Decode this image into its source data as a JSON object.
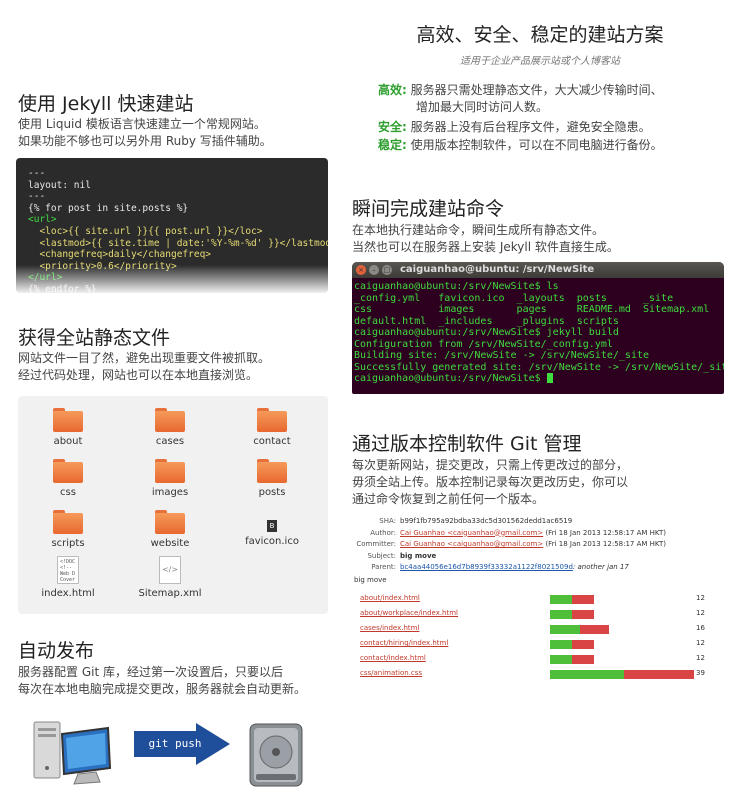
{
  "header": {
    "title": "高效、安全、稳定的建站方案",
    "subtitle": "适用于企业产品展示站或个人博客站",
    "features": [
      {
        "key": "高效:",
        "text": "服务器只需处理静态文件，大大减少传输时间、",
        "text2": "增加最大同时访问人数。"
      },
      {
        "key": "安全:",
        "text": "服务器上没有后台程序文件，避免安全隐患。"
      },
      {
        "key": "稳定:",
        "text": "使用版本控制软件，可以在不同电脑进行备份。"
      }
    ]
  },
  "jekyll": {
    "title": "使用 Jekyll 快速建站",
    "line1": "使用 Liquid 模板语言快速建立一个常规网站。",
    "line2": "如果功能不够也可以另外用 Ruby 写插件辅助。",
    "code": [
      {
        "t": "---",
        "c": "#e8e8e8"
      },
      {
        "t": "layout: nil",
        "c": "#e8e8e8"
      },
      {
        "t": "---",
        "c": "#e8e8e8"
      },
      {
        "t": "{% for post in site.posts %}",
        "c": "#e8e8e8"
      },
      {
        "t": "<url>",
        "c": "#3fdc3f"
      },
      {
        "t": "  <loc>{{ site.url }}{{ post.url }}</loc>",
        "c": "#e6db74"
      },
      {
        "t": "  <lastmod>{{ site.time | date:'%Y-%m-%d' }}</lastmod>",
        "c": "#e6db74"
      },
      {
        "t": "  <changefreq>daily</changefreq>",
        "c": "#e6db74"
      },
      {
        "t": "  <priority>0.6</priority>",
        "c": "#e6db74"
      },
      {
        "t": "</url>",
        "c": "#3fdc3f"
      },
      {
        "t": "{% endfor %}",
        "c": "#e8e8e8"
      }
    ]
  },
  "static": {
    "title": "获得全站静态文件",
    "line1": "网站文件一目了然，避免出现重要文件被抓取。",
    "line2": "经过代码处理，网站也可以在本地直接浏览。",
    "files": [
      "about",
      "cases",
      "contact",
      "css",
      "images",
      "posts",
      "scripts",
      "website",
      "favicon.ico",
      "index.html",
      "Sitemap.xml"
    ],
    "index_preview": "<!DOC\n<!--\nWeb D\nCover",
    "svg_glyph": "</>",
    "favicon_glyph": "B"
  },
  "build": {
    "title": "瞬间完成建站命令",
    "line1": "在本地执行建站命令，瞬间生成所有静态文件。",
    "line2": "当然也可以在服务器上安装 Jekyll 软件直接生成。"
  },
  "terminal": {
    "title": "caiguanhao@ubuntu: /srv/NewSite",
    "lines": [
      {
        "t": "caiguanhao@ubuntu:/srv/NewSite$ ls",
        "w": false
      },
      {
        "t": "_config.yml   favicon.ico  _layouts  posts      _site",
        "w": false
      },
      {
        "t": "css           images       pages     README.md  Sitemap.xml",
        "w": false
      },
      {
        "t": "default.html  _includes    _plugins  scripts",
        "w": false
      },
      {
        "t": "caiguanhao@ubuntu:/srv/NewSite$ jekyll build",
        "w": false
      },
      {
        "t": "Configuration from /srv/NewSite/_config.yml",
        "w": false
      },
      {
        "t": "Building site: /srv/NewSite -> /srv/NewSite/_site",
        "w": false
      },
      {
        "t": "Successfully generated site: /srv/NewSite -> /srv/NewSite/_site",
        "w": false
      },
      {
        "t": "caiguanhao@ubuntu:/srv/NewSite$ ",
        "w": false
      }
    ]
  },
  "git": {
    "title": "通过版本控制软件 Git 管理",
    "line1": "每次更新网站，提交更改，只需上传更改过的部分，",
    "line2": "毋须全站上传。版本控制记录每次更改历史，你可以",
    "line3": "通过命令恢复到之前任何一个版本。",
    "sha_label": "SHA:",
    "sha": "b99f1fb795a92bdba33dc5d301562dedd1ac6519",
    "author_label": "Author:",
    "author": "Cai Guanhao <caiguanhao@gmail.com>",
    "author_date": "(Fri 18 Jan 2013 12:58:17 AM HKT)",
    "committer_label": "Committer:",
    "committer": "Cai Guanhao <caiguanhao@gmail.com>",
    "committer_date": "(Fri 18 Jan 2013 12:58:17 AM HKT)",
    "subject_label": "Subject:",
    "subject": "big move",
    "parent_label": "Parent:",
    "parent": "bc4aa44056e16d7b8939f33332a1122f8021509d",
    "parent_note": ": another jan 17",
    "message": "big move",
    "files": [
      {
        "name": "about/index.html",
        "added": 6,
        "removed": 6,
        "count": "12"
      },
      {
        "name": "about/workplace/index.html",
        "added": 6,
        "removed": 6,
        "count": "12"
      },
      {
        "name": "cases/index.html",
        "added": 8,
        "removed": 8,
        "count": "16"
      },
      {
        "name": "contact/hiring/index.html",
        "added": 6,
        "removed": 6,
        "count": "12"
      },
      {
        "name": "contact/index.html",
        "added": 6,
        "removed": 6,
        "count": "12"
      },
      {
        "name": "css/animation.css",
        "added": 20,
        "removed": 19,
        "count": "39"
      }
    ]
  },
  "deploy": {
    "title": "自动发布",
    "line1": "服务器配置 Git 库，经过第一次设置后，只要以后",
    "line2": "每次在本地电脑完成提交更改，服务器就会自动更新。",
    "arrow_label": "git push"
  },
  "colors": {
    "accent_green": "#2e9e2e",
    "terminal_bg": "#2c001e",
    "folder_orange": "#e8682f",
    "arrow_blue": "#1f4f9a"
  }
}
